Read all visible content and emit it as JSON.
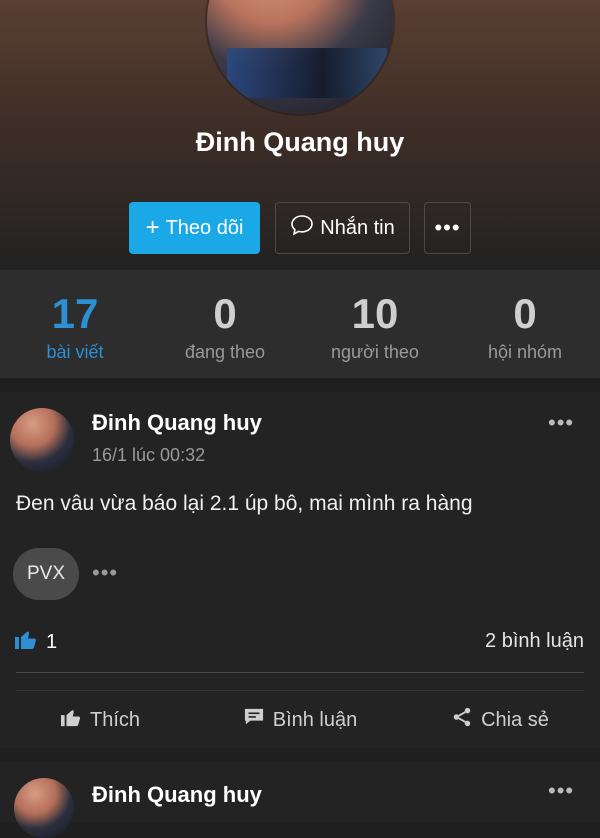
{
  "profile": {
    "name": "Đinh Quang huy",
    "follow_label": "Theo dõi",
    "message_label": "Nhắn tin",
    "more_label": "•••"
  },
  "stats": [
    {
      "value": "17",
      "label": "bài viết",
      "active": true
    },
    {
      "value": "0",
      "label": "đang theo",
      "active": false
    },
    {
      "value": "10",
      "label": "người theo",
      "active": false
    },
    {
      "value": "0",
      "label": "hội nhóm",
      "active": false
    }
  ],
  "post": {
    "author": "Đinh Quang huy",
    "time": "16/1 lúc 00:32",
    "more_label": "•••",
    "text": "Đen vâu vừa báo lại 2.1 úp bô, mai mình ra hàng",
    "tag": "PVX",
    "tag_more": "•••",
    "likes": "1",
    "comments": "2 bình luận",
    "actions": {
      "like": "Thích",
      "comment": "Bình luận",
      "share": "Chia sẻ"
    }
  },
  "post2": {
    "author": "Đinh Quang huy",
    "more_label": "•••"
  },
  "colors": {
    "accent": "#1aa9e6",
    "active_stat": "#2d8fd4"
  }
}
